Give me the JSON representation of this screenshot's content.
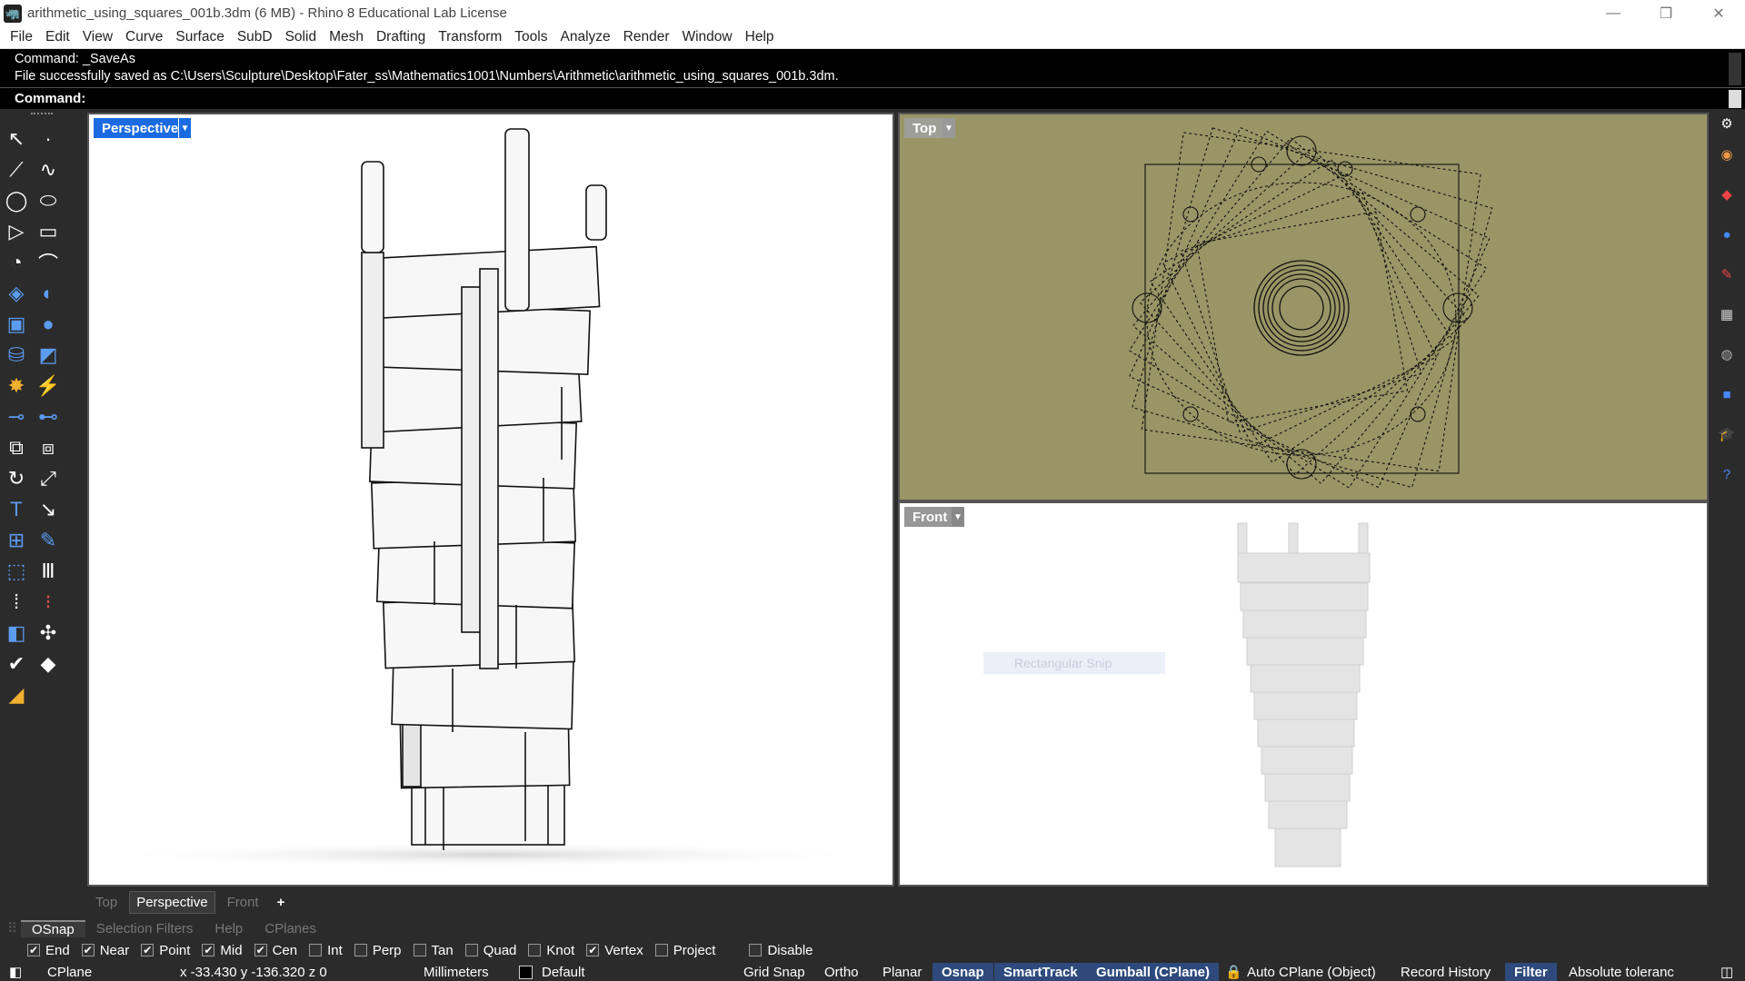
{
  "window": {
    "title": "arithmetic_using_squares_001b.3dm (6 MB) - Rhino 8 Educational Lab License",
    "minimize": "—",
    "maximize": "❐",
    "close": "✕"
  },
  "menu": [
    "File",
    "Edit",
    "View",
    "Curve",
    "Surface",
    "SubD",
    "Solid",
    "Mesh",
    "Drafting",
    "Transform",
    "Tools",
    "Analyze",
    "Render",
    "Window",
    "Help"
  ],
  "command_history": [
    "Command: _SaveAs",
    "File successfully saved as C:\\Users\\Sculpture\\Desktop\\Fater_ss\\Mathematics1001\\Numbers\\Arithmetic\\arithmetic_using_squares_001b.3dm."
  ],
  "command_prompt": "Command:",
  "viewports": {
    "perspective": {
      "label": "Perspective",
      "active": true
    },
    "top": {
      "label": "Top"
    },
    "front": {
      "label": "Front"
    }
  },
  "snip_overlay": "Rectangular Snip",
  "viewport_tabs": [
    "Top",
    "Perspective",
    "Front",
    "+"
  ],
  "panel_tabs": [
    "OSnap",
    "Selection Filters",
    "Help",
    "CPlanes"
  ],
  "osnaps": [
    {
      "label": "End",
      "checked": true
    },
    {
      "label": "Near",
      "checked": true
    },
    {
      "label": "Point",
      "checked": true
    },
    {
      "label": "Mid",
      "checked": true
    },
    {
      "label": "Cen",
      "checked": true
    },
    {
      "label": "Int",
      "checked": false
    },
    {
      "label": "Perp",
      "checked": false
    },
    {
      "label": "Tan",
      "checked": false
    },
    {
      "label": "Quad",
      "checked": false
    },
    {
      "label": "Knot",
      "checked": false
    },
    {
      "label": "Vertex",
      "checked": true
    },
    {
      "label": "Project",
      "checked": false
    },
    {
      "label": "Disable",
      "checked": false
    }
  ],
  "status": {
    "cplane": "CPlane",
    "coords": "x -33.430  y -136.320  z 0",
    "units": "Millimeters",
    "layer": "Default",
    "grid_snap": "Grid Snap",
    "ortho": "Ortho",
    "planar": "Planar",
    "osnap": "Osnap",
    "smarttrack": "SmartTrack",
    "gumball": "Gumball (CPlane)",
    "auto_cplane": "Auto CPlane (Object)",
    "record_history": "Record History",
    "filter": "Filter",
    "tolerance": "Absolute toleranc"
  },
  "colors": {
    "top_viewport_bg": "#9a9566",
    "active_label": "#1a6be0",
    "toggle_on": "#2e4a7c"
  }
}
